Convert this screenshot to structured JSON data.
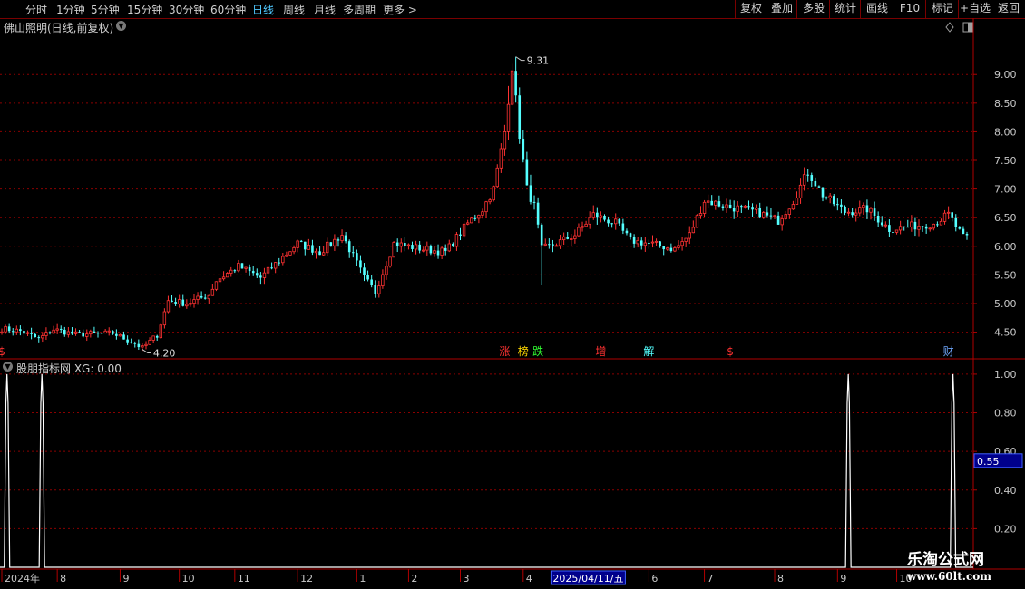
{
  "toolbar": {
    "periods": [
      {
        "label": "分时",
        "active": false
      },
      {
        "label": "1分钟",
        "active": false
      },
      {
        "label": "5分钟",
        "active": false
      },
      {
        "label": "15分钟",
        "active": false
      },
      {
        "label": "30分钟",
        "active": false
      },
      {
        "label": "60分钟",
        "active": false
      },
      {
        "label": "日线",
        "active": true
      },
      {
        "label": "周线",
        "active": false
      },
      {
        "label": "月线",
        "active": false
      },
      {
        "label": "多周期",
        "active": false
      },
      {
        "label": "更多 >",
        "active": false
      }
    ],
    "actions": [
      "复权",
      "叠加",
      "多股",
      "统计",
      "画线",
      "F10",
      "标记",
      "+自选",
      "返回"
    ]
  },
  "main_panel": {
    "title": "佛山照明(日线,前复权)",
    "dropdown_icon": "chevron-down-icon",
    "right_icons": [
      "diamond-icon",
      "layout-icon"
    ]
  },
  "sub_panel": {
    "title": "股朋指标网 XG: 0.00",
    "dropdown_icon": "chevron-down-icon"
  },
  "watermark": {
    "name": "乐淘公式网",
    "url": "www.60lt.com"
  },
  "colors": {
    "up": "#ff3232",
    "down": "#54ffff",
    "grid": "#8a0000",
    "axis_text": "#c8c8c8",
    "accent": "#4fc8ff",
    "cursor_box": "#00008c"
  },
  "chart_data": [
    {
      "type": "candlestick",
      "ylim": [
        4.05,
        9.7
      ],
      "y_ticks": [
        "4.50",
        "5.00",
        "5.50",
        "6.00",
        "6.50",
        "7.00",
        "7.50",
        "8.00",
        "8.50",
        "9.00"
      ],
      "max_label": "9.31",
      "min_label": "4.20",
      "n_bars": 262,
      "x_months": [
        {
          "label": "2024年",
          "index": 0
        },
        {
          "label": "8",
          "index": 15
        },
        {
          "label": "9",
          "index": 32
        },
        {
          "label": "10",
          "index": 48
        },
        {
          "label": "11",
          "index": 63
        },
        {
          "label": "12",
          "index": 80
        },
        {
          "label": "1",
          "index": 96
        },
        {
          "label": "2",
          "index": 110
        },
        {
          "label": "3",
          "index": 124
        },
        {
          "label": "4",
          "index": 141
        },
        {
          "label": "6",
          "index": 175
        },
        {
          "label": "7",
          "index": 190
        },
        {
          "label": "8",
          "index": 209
        },
        {
          "label": "9",
          "index": 226
        },
        {
          "label": "10",
          "index": 242
        }
      ],
      "cursor_label": "2025/04/11/五",
      "cursor_index": 149,
      "keypoints": [
        [
          0,
          4.56
        ],
        [
          5,
          4.52
        ],
        [
          10,
          4.38
        ],
        [
          14,
          4.55
        ],
        [
          20,
          4.46
        ],
        [
          30,
          4.48
        ],
        [
          36,
          4.3
        ],
        [
          38,
          4.22
        ],
        [
          42,
          4.45
        ],
        [
          45,
          5.05
        ],
        [
          50,
          5.0
        ],
        [
          56,
          5.15
        ],
        [
          58,
          5.4
        ],
        [
          64,
          5.65
        ],
        [
          70,
          5.45
        ],
        [
          80,
          6.05
        ],
        [
          86,
          5.9
        ],
        [
          92,
          6.2
        ],
        [
          98,
          5.45
        ],
        [
          101,
          5.2
        ],
        [
          106,
          6.05
        ],
        [
          114,
          5.95
        ],
        [
          120,
          5.9
        ],
        [
          126,
          6.4
        ],
        [
          130,
          6.65
        ],
        [
          133,
          7.0
        ],
        [
          136,
          8.0
        ],
        [
          138,
          9.15
        ],
        [
          140,
          7.95
        ],
        [
          142,
          7.0
        ],
        [
          144,
          6.7
        ],
        [
          146,
          5.95
        ],
        [
          150,
          6.05
        ],
        [
          155,
          6.2
        ],
        [
          160,
          6.55
        ],
        [
          166,
          6.4
        ],
        [
          170,
          6.1
        ],
        [
          175,
          6.05
        ],
        [
          182,
          5.95
        ],
        [
          186,
          6.2
        ],
        [
          190,
          6.8
        ],
        [
          196,
          6.7
        ],
        [
          204,
          6.6
        ],
        [
          210,
          6.45
        ],
        [
          214,
          6.8
        ],
        [
          218,
          7.3
        ],
        [
          222,
          6.9
        ],
        [
          228,
          6.6
        ],
        [
          234,
          6.65
        ],
        [
          240,
          6.3
        ],
        [
          246,
          6.35
        ],
        [
          252,
          6.4
        ],
        [
          256,
          6.55
        ],
        [
          260,
          6.15
        ],
        [
          261,
          6.15
        ]
      ],
      "spikes": [
        [
          134,
          7.18
        ],
        [
          135,
          7.35
        ],
        [
          137,
          8.8
        ],
        [
          139,
          9.31
        ],
        [
          140,
          8.6
        ],
        [
          141,
          7.9
        ],
        [
          143,
          7.25
        ],
        [
          145,
          6.8
        ]
      ],
      "special_lows": [
        [
          38,
          4.2
        ],
        [
          146,
          5.32
        ],
        [
          101,
          5.1
        ]
      ],
      "event_markers": [
        {
          "text": "$",
          "index": 0,
          "color": "#ff3232"
        },
        {
          "text": "涨",
          "index": 136,
          "color": "#ff3232"
        },
        {
          "text": "榜",
          "index": 141,
          "color": "#ffd700"
        },
        {
          "text": "跌",
          "index": 145,
          "color": "#32ff32"
        },
        {
          "text": "增",
          "index": 162,
          "color": "#ff3232"
        },
        {
          "text": "解",
          "index": 175,
          "color": "#54ffff"
        },
        {
          "text": "$",
          "index": 197,
          "color": "#ff3232"
        },
        {
          "text": "财",
          "index": 256,
          "color": "#6fa8ff"
        }
      ]
    },
    {
      "type": "line",
      "title": "XG",
      "ylim": [
        0,
        1.07
      ],
      "y_ticks": [
        "0.20",
        "0.40",
        "0.60",
        "0.80",
        "1.00"
      ],
      "cursor_value": "0.55",
      "spikes_at": [
        2,
        12,
        243,
        273
      ]
    }
  ]
}
